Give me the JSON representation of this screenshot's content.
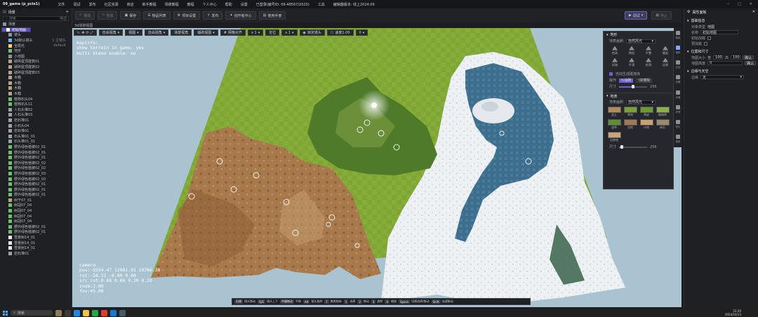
{
  "app": {
    "title": "09_game (p_pcie1)",
    "menu": [
      "文件",
      "调试",
      "发布",
      "社区资源",
      "商店",
      "新手教程",
      "场景教程",
      "教程",
      "个人中心",
      "帮助",
      "设置",
      "已登录(编号ID: 09-48567/2020)",
      "工具",
      "编辑器版本: 线上2024.09"
    ]
  },
  "toolbar": {
    "buttons": [
      "撤销",
      "重做",
      "保存",
      "物品列表",
      "项目设置",
      "发布",
      "创作者中心",
      "使用手册"
    ],
    "debug": "调试",
    "stop": "停止"
  },
  "left_panel": {
    "title": "场景",
    "search_placeholder": "搜索",
    "search_extra": "筛选",
    "rows": [
      {
        "label": "场景",
        "color": "#8d93a0"
      },
      {
        "label": "初始地图",
        "color": "#ffffff",
        "selected": true
      },
      {
        "label": "镜头",
        "color": "#8d93a0"
      },
      {
        "label": "3d默认镜头",
        "color": "#6fb3ff",
        "right": "1 主镜头"
      },
      {
        "label": "全局光",
        "color": "#ffd166",
        "right": "default"
      },
      {
        "label": "地形",
        "color": "#6fbf73"
      },
      {
        "label": "小地图",
        "color": "#8d93a0"
      },
      {
        "label": "破碎屋顶建筑01",
        "color": "#b3a58b"
      },
      {
        "label": "破碎屋顶建筑02",
        "color": "#b3a58b"
      },
      {
        "label": "破碎屋顶建筑03",
        "color": "#b3a58b"
      },
      {
        "label": "木箱",
        "color": "#b3a58b"
      },
      {
        "label": "木箱",
        "color": "#b3a58b"
      },
      {
        "label": "木箱",
        "color": "#b3a58b"
      },
      {
        "label": "木箱",
        "color": "#b3a58b"
      },
      {
        "label": "植物石头04",
        "color": "#6fbf73"
      },
      {
        "label": "植物石头11",
        "color": "#6fbf73"
      },
      {
        "label": "人石头堆02",
        "color": "#9da1a9"
      },
      {
        "label": "人石头堆03",
        "color": "#9da1a9"
      },
      {
        "label": "岩石堆01",
        "color": "#9da1a9"
      },
      {
        "label": "小石头04",
        "color": "#9da1a9"
      },
      {
        "label": "岩石堆01",
        "color": "#9da1a9"
      },
      {
        "label": "石头堆01_01",
        "color": "#9da1a9"
      },
      {
        "label": "石头堆01_01",
        "color": "#9da1a9"
      },
      {
        "label": "野外绿色植被02_01",
        "color": "#6fbf73"
      },
      {
        "label": "野外绿色植被02_01",
        "color": "#6fbf73"
      },
      {
        "label": "野外绿色植被02_01",
        "color": "#6fbf73"
      },
      {
        "label": "野外绿色植被02_02",
        "color": "#6fbf73"
      },
      {
        "label": "野外绿色植被02_02",
        "color": "#6fbf73"
      },
      {
        "label": "野外绿色植被02_03",
        "color": "#6fbf73"
      },
      {
        "label": "野外绿色植被02_03",
        "color": "#6fbf73"
      },
      {
        "label": "野外绿色植被02_01",
        "color": "#6fbf73"
      },
      {
        "label": "野外绿色植被02_01",
        "color": "#6fbf73"
      },
      {
        "label": "野外绿色植被02_01",
        "color": "#6fbf73"
      },
      {
        "label": "树干07_01",
        "color": "#b3a58b"
      },
      {
        "label": "树冠07_04",
        "color": "#6fbf73"
      },
      {
        "label": "树冠07_04",
        "color": "#6fbf73"
      },
      {
        "label": "树冠07_04",
        "color": "#6fbf73"
      },
      {
        "label": "树冠07_04",
        "color": "#6fbf73"
      },
      {
        "label": "野外绿色植被02_01",
        "color": "#6fbf73"
      },
      {
        "label": "野外绿色植被02_01",
        "color": "#6fbf73"
      },
      {
        "label": "雪景树14_01",
        "color": "#e5e7eb"
      },
      {
        "label": "雪景树14_01",
        "color": "#e5e7eb"
      },
      {
        "label": "雪景树14_01",
        "color": "#e5e7eb"
      },
      {
        "label": "岩石堆01",
        "color": "#9da1a9"
      }
    ]
  },
  "viewport": {
    "tab": "3d场景视图",
    "tools": [
      "自由视角",
      "视图",
      "自由视角",
      "场景视角",
      "辅助视图",
      "网格对齐",
      "x 1",
      "定位",
      "x 1",
      "锁定镜头",
      "速度1.00",
      "0"
    ],
    "info_text": "mapinfo:\nshow terrain in game: yes\nmulti blend enable: no",
    "camera_text": "camera\npos:-5554.47 12981.91 19786.38\nrot:-56.31 -0.00 0.00\nsrc rot:0.68 0.68 0.20 0.20\nzoom:1.00\nfov:45.00"
  },
  "terrain_panel": {
    "title": "地形",
    "brush_label": "地表画刷",
    "brush_value": "自然风光",
    "tools": [
      "抬高",
      "降低",
      "平整",
      "隆起",
      "风蚀",
      "平滑",
      "挖洞",
      "还原"
    ],
    "check_label": "自动生成碰撞体",
    "operate_label": "操作",
    "operate_on": "涂刷",
    "operate_off": "擦除",
    "size_label": "尺寸",
    "size_unit": "256",
    "size_value": 0.5,
    "texture_title": "地表",
    "texture_brush_label": "地表画刷",
    "texture_brush_value": "自然风光",
    "textures": [
      {
        "label": "泥土",
        "color": "#b58a5a"
      },
      {
        "label": "草地",
        "color": "#7ba13a"
      },
      {
        "label": "草皮",
        "color": "#6a9a34"
      },
      {
        "label": "稀疏草",
        "color": "#8db04a"
      },
      {
        "label": "湿草",
        "color": "#5f8f2f"
      },
      {
        "label": "泥地",
        "color": "#a07a4e"
      },
      {
        "label": "沙地",
        "color": "#c9a36b"
      },
      {
        "label": "碎石",
        "color": "#9b8a6d"
      },
      {
        "label": "石砖地",
        "color": "#c6a57c"
      }
    ],
    "texture_size_label": "尺寸",
    "texture_size_value": "256",
    "texture_size_fraction": 0.1
  },
  "right_strip": [
    "物品",
    "地形",
    "天空",
    "光照",
    "水面",
    "环境",
    "镜头",
    "音效"
  ],
  "right_panel": {
    "title": "属性面板",
    "section_basic": "基础信息",
    "object_type_label": "对象类型",
    "object_type_value": "地图",
    "name_label": "名称",
    "name_value": "初始地图",
    "init_load_label": "初始加载",
    "preload_label": "预加载",
    "section_size": "位置和尺寸",
    "map_size_label": "地图大小",
    "map_w_label": "宽",
    "map_w": "100",
    "map_h_label": "高",
    "map_h": "100",
    "confirm": "确认",
    "height_label": "地图高度",
    "height_value": "0",
    "confirm2": "确认",
    "section_fog": "边缘与天空",
    "fog_label": "边缘",
    "fog_value": "无"
  },
  "shortcuts": [
    {
      "key": "右键",
      "label": "镜头移动"
    },
    {
      "key": "Q/E",
      "label": "镜头上下"
    },
    {
      "key": "中键拖动",
      "label": "平移"
    },
    {
      "key": "Alt",
      "label": "镜头旋转"
    },
    {
      "key": "F",
      "label": "聚焦物体"
    },
    {
      "key": "1",
      "label": "选择"
    },
    {
      "key": "2",
      "label": "移动"
    },
    {
      "key": "3",
      "label": "旋转"
    },
    {
      "key": "4",
      "label": "缩放"
    },
    {
      "key": "Space",
      "label": "切换选择/移动"
    },
    {
      "key": "Shift",
      "label": "加速移动"
    }
  ],
  "taskbar": {
    "search": "搜索",
    "time": "21:20",
    "date": "2024/10/13"
  },
  "colors": {
    "accent": "#6f5fd3",
    "grass": "#7fa534",
    "dirt": "#a8794b",
    "snow": "#eef1f4",
    "water": "#3e6e8e"
  }
}
